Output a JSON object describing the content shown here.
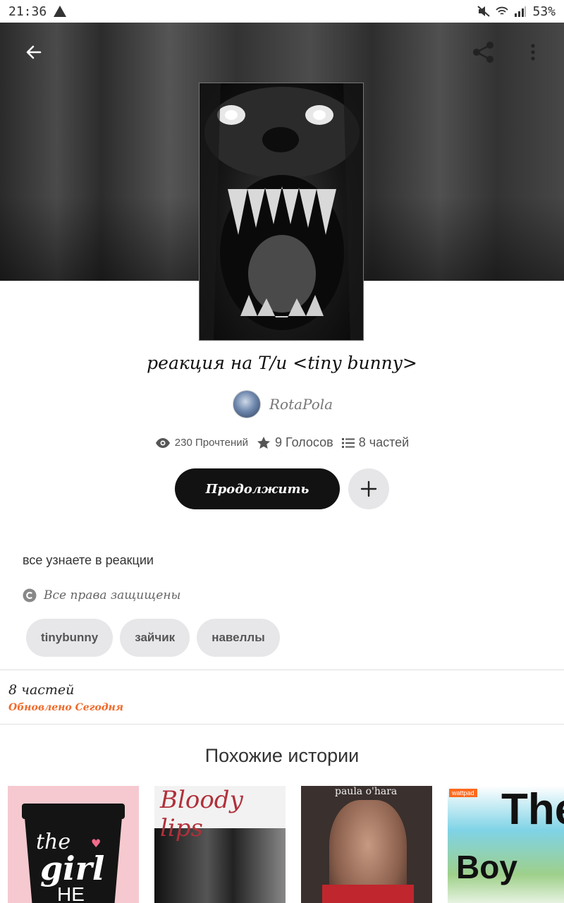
{
  "status_bar": {
    "time": "21:36",
    "battery": "53%"
  },
  "nav": {
    "back_icon": "arrow-left-icon",
    "share_icon": "share-icon",
    "more_icon": "more-vertical-icon"
  },
  "story": {
    "title": "реакция на Т/и <tiny bunny>",
    "author": "RotaPola",
    "reads": "230 Прочтений",
    "votes": "9 Голосов",
    "parts": "8 частей",
    "continue_label": "Продолжить",
    "description": "все узнаете в реакции",
    "copyright": "Все права защищены",
    "tags": [
      "tinybunny",
      "зайчик",
      "навеллы"
    ]
  },
  "parts_section": {
    "label": "8 частей",
    "updated": "Обновлено Сегодня"
  },
  "similar": {
    "title": "Похожие истории",
    "books": [
      {
        "cover_text_1": "the",
        "cover_text_2": "girl",
        "cover_text_3": "HE"
      },
      {
        "cover_text_1": "Bloody lips"
      },
      {
        "cover_text_1": "paula o'hara"
      },
      {
        "cover_text_1": "The",
        "cover_text_2": "Boy",
        "badge": "wattpad"
      }
    ]
  },
  "colors": {
    "accent_orange": "#f06a2a",
    "button_dark": "#121212",
    "chip_bg": "#e7e6e9"
  }
}
